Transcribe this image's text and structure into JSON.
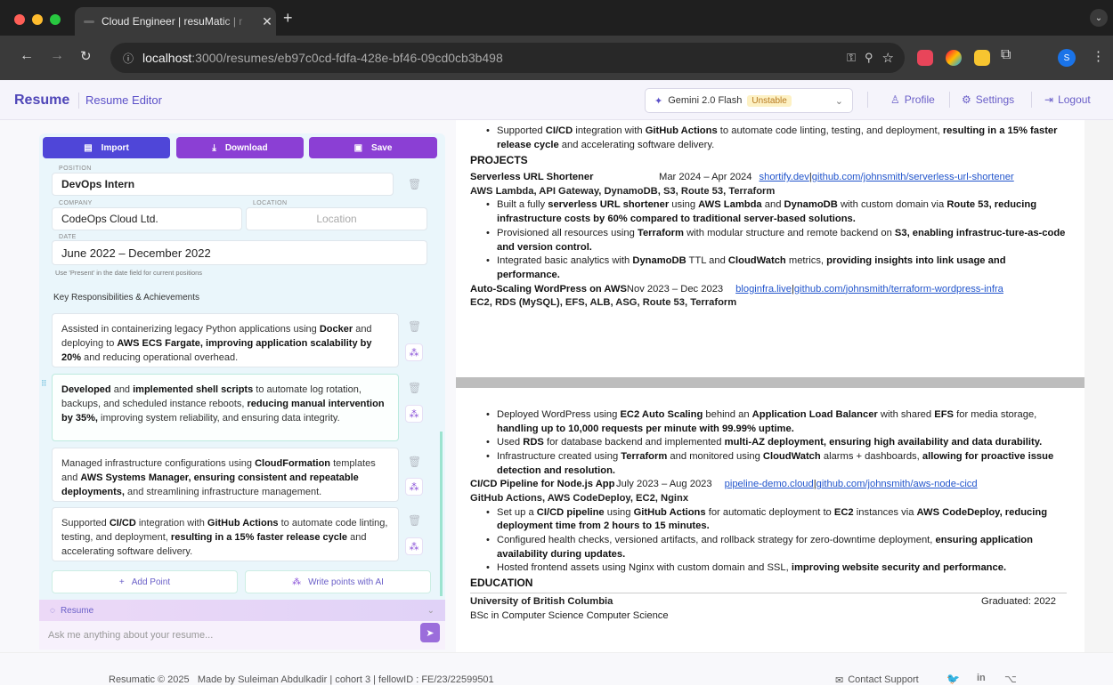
{
  "browser": {
    "tab_title": "Cloud Engineer | resuMatic | r",
    "url_host": "localhost",
    "url_path": ":3000/resumes/eb97c0cd-fdfa-428e-bf46-09cd0cb3b498",
    "profile_initial": "S"
  },
  "header": {
    "brand": "Resume",
    "editor_link": "Resume Editor",
    "model_name": "Gemini 2.0 Flash",
    "model_badge": "Unstable",
    "profile": "Profile",
    "settings": "Settings",
    "logout": "Logout"
  },
  "toolbar": {
    "import": "Import",
    "download": "Download",
    "save": "Save"
  },
  "experience": {
    "position_label": "POSITION",
    "position": "DevOps Intern",
    "company_label": "COMPANY",
    "company": "CodeOps Cloud Ltd.",
    "location_label": "LOCATION",
    "location_placeholder": "Location",
    "date_label": "DATE",
    "date": "June 2022 – December 2022",
    "date_hint": "Use 'Present' in the date field for current positions",
    "section_title": "Key Responsibilities & Achievements",
    "add_point": "Add Point",
    "write_ai": "Write points with AI"
  },
  "points": [
    {
      "pre": "Assisted in containerizing legacy Python applications using ",
      "b1": "Docker",
      "mid": " and deploying to ",
      "b2": "AWS ECS Fargate, improving application scalability by 20%",
      "post": " and reducing operational overhead."
    },
    {
      "pre": "",
      "b1": "Developed",
      "mid": " and ",
      "b2": "implemented shell scripts",
      "post": " to automate log rotation, backups, and scheduled instance reboots, ",
      "b3": "reducing manual intervention by 35%,",
      "post2": " improving system reliability, and ensuring data integrity."
    },
    {
      "pre": "Managed infrastructure configurations using ",
      "b1": "CloudFormation",
      "mid": " templates and ",
      "b2": "AWS Systems Manager, ensuring consistent and repeatable deployments,",
      "post": " and streamlining infrastructure management."
    },
    {
      "pre": "Supported ",
      "b1": "CI/CD",
      "mid": " integration with ",
      "b2": "GitHub Actions",
      "post": " to automate code linting, testing, and deployment, ",
      "b3": "resulting in a 15% faster release cycle",
      "post2": " and accelerating software delivery."
    }
  ],
  "chat": {
    "title": "Resume",
    "placeholder": "Ask me anything about your resume..."
  },
  "resume": {
    "top_bullet": {
      "pre": "Supported ",
      "b1": "CI/CD",
      "mid": " integration with ",
      "b2": "GitHub Actions",
      "post": " to automate code linting, testing, and deployment, ",
      "b3": "resulting in a 15% faster release cycle",
      "post2": " and accelerating software delivery."
    },
    "projects_heading": "PROJECTS",
    "p1": {
      "name": "Serverless URL Shortener",
      "dates": "Mar 2024 – Apr 2024",
      "link1": "shortify.dev",
      "sep": " | ",
      "link2": "github.com/johnsmith/serverless-url-shortener",
      "tech": "AWS Lambda, API Gateway, DynamoDB, S3, Route 53, Terraform",
      "b1": {
        "pre": "Built a fully ",
        "b1": "serverless URL shortener",
        "mid": " using ",
        "b2": "AWS Lambda",
        "mid2": " and ",
        "b3": "DynamoDB",
        "mid3": " with custom domain via ",
        "b4": "Route 53, reducing infrastructure costs by 60% compared to traditional server-based solutions."
      },
      "b2": {
        "pre": "Provisioned all resources using ",
        "b1": "Terraform",
        "mid": " with modular structure and remote backend on ",
        "b2": "S3, enabling infrastruc-ture-as-code and version control."
      },
      "b3": {
        "pre": "Integrated basic analytics with ",
        "b1": "DynamoDB",
        "mid": " TTL and ",
        "b2": "CloudWatch",
        "mid2": " metrics, ",
        "b3": "providing insights into link usage and performance."
      }
    },
    "p2": {
      "name": "Auto-Scaling WordPress on AWS",
      "dates": "Nov 2023 – Dec 2023",
      "link1": "bloginfra.live",
      "sep": " | ",
      "link2": "github.com/johnsmith/terraform-wordpress-infra",
      "tech": "EC2, RDS (MySQL), EFS, ALB, ASG, Route 53, Terraform",
      "b1": {
        "pre": "Deployed WordPress using ",
        "b1": "EC2 Auto Scaling",
        "mid": " behind an ",
        "b2": "Application Load Balancer",
        "mid2": " with shared ",
        "b3": "EFS",
        "mid3": " for media storage, ",
        "b4": "handling up to 10,000 requests per minute with 99.99% uptime."
      },
      "b2": {
        "pre": "Used ",
        "b1": "RDS",
        "mid": " for database backend and implemented ",
        "b2": "multi-AZ deployment, ensuring high availability and data durability."
      },
      "b3": {
        "pre": "Infrastructure created using ",
        "b1": "Terraform",
        "mid": " and monitored using ",
        "b2": "CloudWatch",
        "mid2": " alarms + dashboards, ",
        "b3": "allowing for proactive issue detection and resolution."
      }
    },
    "p3": {
      "name": "CI/CD Pipeline for Node.js App",
      "dates": "July 2023 – Aug 2023",
      "link1": "pipeline-demo.cloud",
      "sep": " | ",
      "link2": "github.com/johnsmith/aws-node-cicd",
      "tech": "GitHub Actions, AWS CodeDeploy, EC2, Nginx",
      "b1": {
        "pre": "Set up a ",
        "b1": "CI/CD pipeline",
        "mid": " using ",
        "b2": "GitHub Actions",
        "mid2": " for automatic deployment to ",
        "b3": "EC2",
        "mid3": " instances via ",
        "b4": "AWS CodeDeploy, reducing deployment time from 2 hours to 15 minutes."
      },
      "b2": {
        "pre": "Configured health checks, versioned artifacts, and rollback strategy for zero-downtime deployment, ",
        "b1": "ensuring application availability during updates."
      },
      "b3": {
        "pre": "Hosted frontend assets using Nginx with custom domain and SSL, ",
        "b1": "improving website security and performance."
      }
    },
    "education_heading": "EDUCATION",
    "school": "University of British Columbia",
    "graduated": "Graduated: 2022",
    "degree": "BSc in Computer Science Computer Science"
  },
  "footer": {
    "left": "Resumatic © 2025   Made by Suleiman Abdulkadir | cohort 3 | fellowID : FE/23/22599501",
    "contact": "Contact Support"
  }
}
